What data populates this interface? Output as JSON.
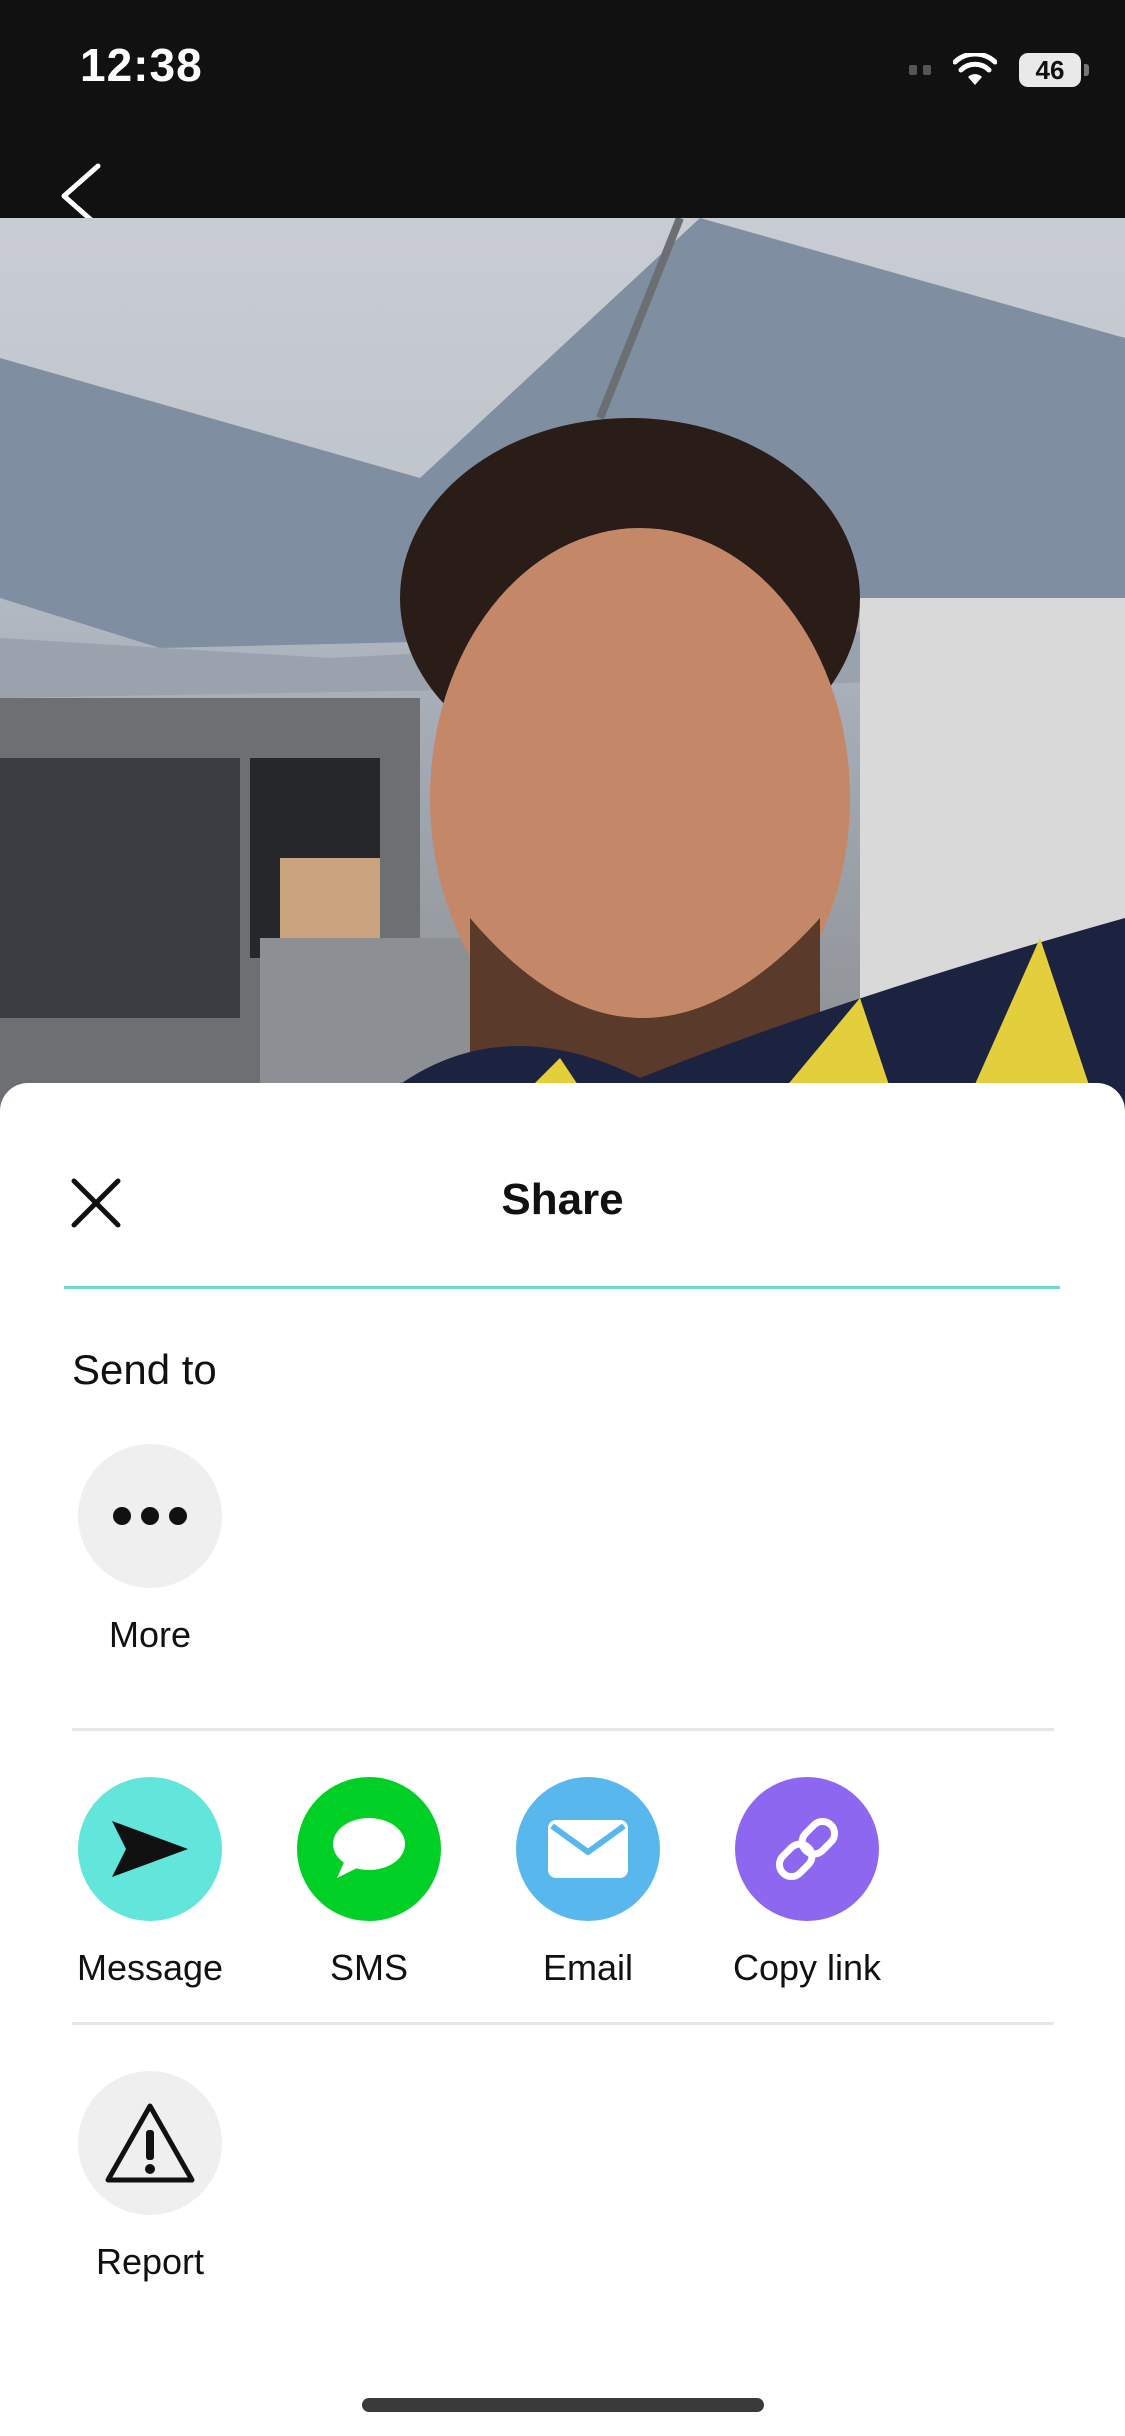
{
  "status_bar": {
    "time": "12:38",
    "battery": "46"
  },
  "share_sheet": {
    "title": "Share",
    "send_to_label": "Send to",
    "send_to_items": [
      {
        "label": "More",
        "icon": "more-dots-icon",
        "bg": "#efefef"
      }
    ],
    "apps": [
      {
        "label": "Message",
        "icon": "send-arrow-icon",
        "bg": "#62e6dc"
      },
      {
        "label": "SMS",
        "icon": "speech-bubble-icon",
        "bg": "#00d026"
      },
      {
        "label": "Email",
        "icon": "envelope-icon",
        "bg": "#58b7ec"
      },
      {
        "label": "Copy link",
        "icon": "link-icon",
        "bg": "#8e67f0"
      }
    ],
    "other": [
      {
        "label": "Report",
        "icon": "warning-icon",
        "bg": "#efefef"
      }
    ],
    "accent_color": "#6fd6d2"
  }
}
